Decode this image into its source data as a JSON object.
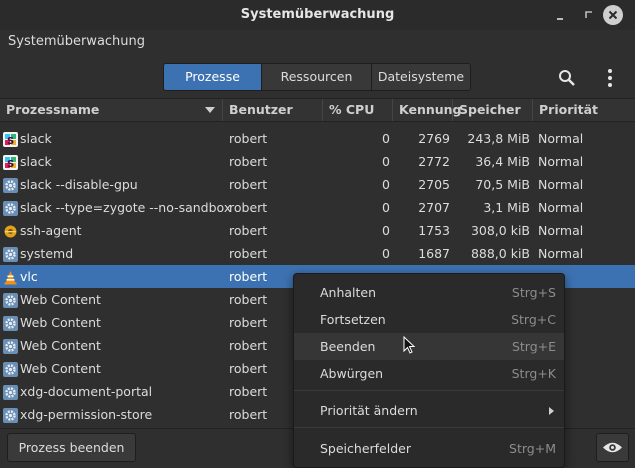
{
  "window": {
    "title": "Systemüberwachung"
  },
  "app_menu": "Systemüberwachung",
  "tabs": [
    {
      "label": "Prozesse",
      "active": true
    },
    {
      "label": "Ressourcen",
      "active": false
    },
    {
      "label": "Dateisysteme",
      "active": false
    }
  ],
  "columns": {
    "name": "Prozessname",
    "user": "Benutzer",
    "cpu": "% CPU",
    "pid": "Kennung",
    "mem": "Speicher",
    "prio": "Priorität"
  },
  "processes": [
    {
      "icon": "slack-icon",
      "name": "slack",
      "user": "robert",
      "cpu": "0",
      "pid": "2769",
      "mem": "243,8 MiB",
      "prio": "Normal"
    },
    {
      "icon": "slack-icon",
      "name": "slack",
      "user": "robert",
      "cpu": "0",
      "pid": "2772",
      "mem": "36,4 MiB",
      "prio": "Normal"
    },
    {
      "icon": "gear-icon",
      "name": "slack --disable-gpu",
      "user": "robert",
      "cpu": "0",
      "pid": "2705",
      "mem": "70,5 MiB",
      "prio": "Normal"
    },
    {
      "icon": "gear-icon",
      "name": "slack --type=zygote --no-sandbox",
      "user": "robert",
      "cpu": "0",
      "pid": "2707",
      "mem": "3,1 MiB",
      "prio": "Normal"
    },
    {
      "icon": "key-icon",
      "name": "ssh-agent",
      "user": "robert",
      "cpu": "0",
      "pid": "1753",
      "mem": "308,0 kiB",
      "prio": "Normal"
    },
    {
      "icon": "gear-icon",
      "name": "systemd",
      "user": "robert",
      "cpu": "0",
      "pid": "1687",
      "mem": "888,0 kiB",
      "prio": "Normal"
    },
    {
      "icon": "vlc-icon",
      "name": "vlc",
      "user": "robert",
      "cpu": "",
      "pid": "",
      "mem": "",
      "prio": "",
      "selected": true
    },
    {
      "icon": "gear-icon",
      "name": "Web Content",
      "user": "robert",
      "cpu": "",
      "pid": "",
      "mem": "",
      "prio": ""
    },
    {
      "icon": "gear-icon",
      "name": "Web Content",
      "user": "robert",
      "cpu": "",
      "pid": "",
      "mem": "",
      "prio": ""
    },
    {
      "icon": "gear-icon",
      "name": "Web Content",
      "user": "robert",
      "cpu": "",
      "pid": "",
      "mem": "",
      "prio": ""
    },
    {
      "icon": "gear-icon",
      "name": "Web Content",
      "user": "robert",
      "cpu": "",
      "pid": "",
      "mem": "",
      "prio": ""
    },
    {
      "icon": "gear-icon",
      "name": "xdg-document-portal",
      "user": "robert",
      "cpu": "",
      "pid": "",
      "mem": "",
      "prio": ""
    },
    {
      "icon": "gear-icon",
      "name": "xdg-permission-store",
      "user": "robert",
      "cpu": "",
      "pid": "",
      "mem": "",
      "prio": ""
    }
  ],
  "footer": {
    "end_button": "Prozess beenden"
  },
  "context_menu": {
    "items": [
      {
        "label": "Anhalten",
        "accel": "Strg+S"
      },
      {
        "label": "Fortsetzen",
        "accel": "Strg+C"
      },
      {
        "label": "Beenden",
        "accel": "Strg+E",
        "hover": true
      },
      {
        "label": "Abwürgen",
        "accel": "Strg+K"
      },
      {
        "label": "Priorität ändern",
        "accel": "",
        "submenu": true
      },
      {
        "label": "Speicherfelder",
        "accel": "Strg+M"
      }
    ]
  },
  "colors": {
    "accent": "#3d72b2",
    "background": "#2f2f2f",
    "menu_background": "#2a2a2a"
  }
}
